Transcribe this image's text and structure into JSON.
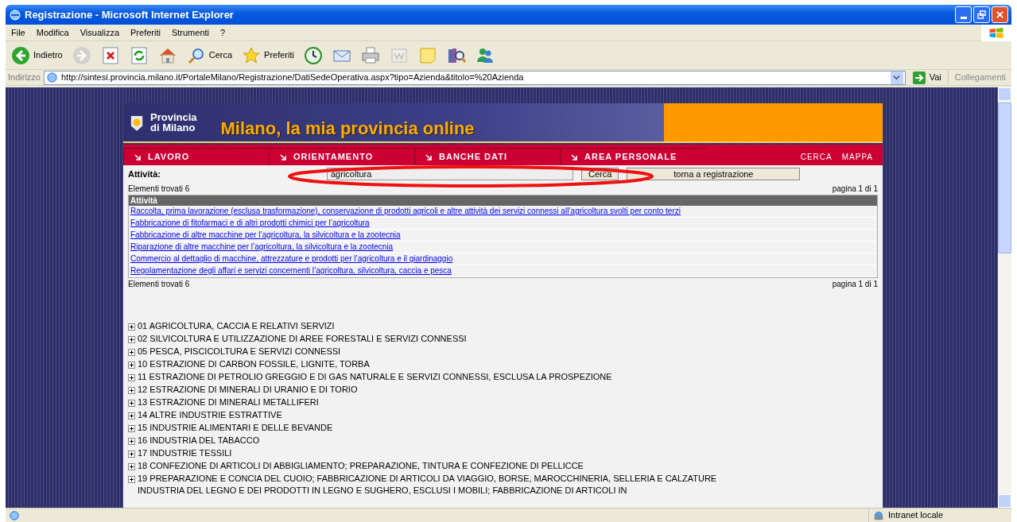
{
  "window": {
    "title": "Registrazione - Microsoft Internet Explorer"
  },
  "menu": [
    "File",
    "Modifica",
    "Visualizza",
    "Preferiti",
    "Strumenti",
    "?"
  ],
  "toolbar": [
    {
      "kind": "back",
      "label": "Indietro",
      "disabled": false
    },
    {
      "kind": "forward",
      "disabled": true
    },
    {
      "kind": "stop",
      "disabled": false
    },
    {
      "kind": "refresh",
      "disabled": false
    },
    {
      "kind": "home",
      "disabled": false
    },
    {
      "kind": "search",
      "label": "Cerca",
      "disabled": false
    },
    {
      "kind": "favorites",
      "label": "Preferiti",
      "disabled": false
    },
    {
      "kind": "history",
      "disabled": false
    },
    {
      "kind": "mail",
      "disabled": false
    },
    {
      "kind": "print",
      "disabled": false
    },
    {
      "kind": "edit",
      "disabled": true
    },
    {
      "kind": "note",
      "disabled": false
    },
    {
      "kind": "research",
      "disabled": false
    },
    {
      "kind": "messenger",
      "disabled": false
    }
  ],
  "address": {
    "label": "Indirizzo",
    "url": "http://sintesi.provincia.milano.it/PortaleMilano/Registrazione/DatiSedeOperativa.aspx?tipo=Azienda&titolo=%20Azienda",
    "go": "Vai",
    "links": "Collegamenti"
  },
  "banner": {
    "org_line1": "Provincia",
    "org_line2": "di Milano",
    "slogan": "Milano, la mia provincia online"
  },
  "nav": {
    "tabs": [
      "LAVORO",
      "ORIENTAMENTO",
      "BANCHE DATI",
      "AREA PERSONALE"
    ],
    "links": [
      "CERCA",
      "MAPPA"
    ]
  },
  "search": {
    "label": "Attività:",
    "value": "agricoltura",
    "button": "Cerca",
    "back_button": "torna a registrazione",
    "highlighted": true
  },
  "results": {
    "count_top": "Elementi trovati 6",
    "page_top": "pagina 1 di 1",
    "column": "Attività",
    "rows": [
      "Raccolta, prima lavorazione (esclusa trasformazione), conservazione di prodotti agricoli e altre attività dei servizi connessi all’agricoltura svolti per conto terzi",
      "Fabbricazione di fitofarmaci e di altri prodotti chimici per l’agricoltura",
      "Fabbricazione di altre macchine per l’agricoltura, la silvicoltura e la zootecnia",
      "Riparazione di altre macchine per l’agricoltura, la silvicoltura e la zootecnia",
      "Commercio al dettaglio di macchine, attrezzature e prodotti per l’agricoltura e il giardinaggio",
      "Regolamentazione degli affari e servizi concernenti l’agricoltura, silvicoltura, caccia e pesca"
    ],
    "count_bottom": "Elementi trovati 6",
    "page_bottom": "pagina 1 di 1"
  },
  "tree": [
    {
      "code": "01",
      "label": "AGRICOLTURA, CACCIA E RELATIVI SERVIZI",
      "expanded": false
    },
    {
      "code": "02",
      "label": "SILVICOLTURA E UTILIZZAZIONE DI AREE FORESTALI E SERVIZI CONNESSI",
      "expanded": false
    },
    {
      "code": "05",
      "label": "PESCA, PISCICOLTURA E SERVIZI CONNESSI",
      "expanded": false
    },
    {
      "code": "10",
      "label": "ESTRAZIONE DI CARBON FOSSILE, LIGNITE, TORBA",
      "expanded": false
    },
    {
      "code": "11",
      "label": "ESTRAZIONE DI PETROLIO GREGGIO E DI GAS NATURALE E SERVIZI CONNESSI, ESCLUSA LA PROSPEZIONE",
      "expanded": false
    },
    {
      "code": "12",
      "label": "ESTRAZIONE DI MINERALI DI URANIO E DI TORIO",
      "expanded": false
    },
    {
      "code": "13",
      "label": "ESTRAZIONE DI MINERALI METALLIFERI",
      "expanded": false
    },
    {
      "code": "14",
      "label": "ALTRE INDUSTRIE ESTRATTIVE",
      "expanded": false
    },
    {
      "code": "15",
      "label": "INDUSTRIE ALIMENTARI E DELLE BEVANDE",
      "expanded": false
    },
    {
      "code": "16",
      "label": "INDUSTRIA DEL TABACCO",
      "expanded": false
    },
    {
      "code": "17",
      "label": "INDUSTRIE TESSILI",
      "expanded": false
    },
    {
      "code": "18",
      "label": "CONFEZIONE DI ARTICOLI DI ABBIGLIAMENTO; PREPARAZIONE, TINTURA E CONFEZIONE DI PELLICCE",
      "expanded": false
    },
    {
      "code": "19",
      "label": "PREPARAZIONE E CONCIA DEL CUOIO; FABBRICAZIONE DI ARTICOLI DA VIAGGIO, BORSE, MAROCCHINERIA, SELLERIA E CALZATURE",
      "expanded": false
    }
  ],
  "tree_cut_line": "INDUSTRIA DEL LEGNO E DEI PRODOTTI IN LEGNO E SUGHERO, ESCLUSI I MOBILI; FABBRICAZIONE DI ARTICOLI IN",
  "status_bar": {
    "zone": "Intranet locale"
  }
}
